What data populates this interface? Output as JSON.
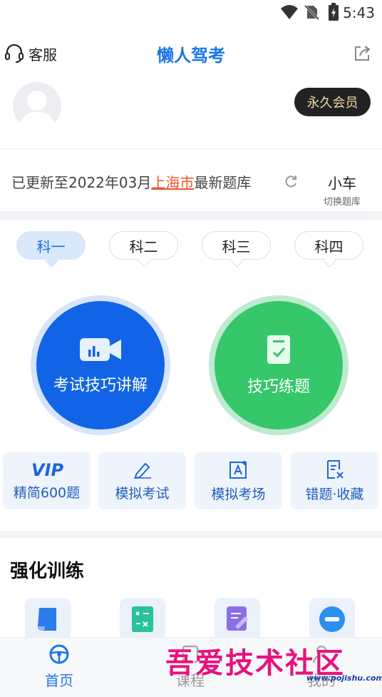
{
  "status_bar": {
    "time": "5:43"
  },
  "header": {
    "title": "懒人驾考",
    "service_label": "客服"
  },
  "member": {
    "badge": "永久会员"
  },
  "update_bar": {
    "prefix": "已更新至2022年03月",
    "city": "上海市",
    "suffix": "最新题库",
    "vehicle": "小车",
    "switch_label": "切换题库"
  },
  "subjects": [
    {
      "label": "科一",
      "active": true
    },
    {
      "label": "科二",
      "active": false
    },
    {
      "label": "科三",
      "active": false
    },
    {
      "label": "科四",
      "active": false
    }
  ],
  "primary_actions": {
    "explain": "考试技巧讲解",
    "practice": "技巧练题"
  },
  "functions": [
    {
      "label": "精简600题",
      "icon": "vip-icon"
    },
    {
      "label": "模拟考试",
      "icon": "pencil-icon"
    },
    {
      "label": "模拟考场",
      "icon": "exam-room-icon"
    },
    {
      "label": "错题·收藏",
      "icon": "wrong-questions-icon"
    }
  ],
  "training": {
    "title": "强化训练"
  },
  "bottom_nav": [
    {
      "label": "首页",
      "active": true
    },
    {
      "label": "课程",
      "active": false
    },
    {
      "label": "我的",
      "active": false
    }
  ],
  "watermark": {
    "text": "吾爱技术社区",
    "url": "www.pojishu.com"
  },
  "colors": {
    "accent": "#1976e6",
    "blue_button": "#1264e6",
    "green_button": "#35c76a",
    "city_highlight": "#e8572e"
  }
}
